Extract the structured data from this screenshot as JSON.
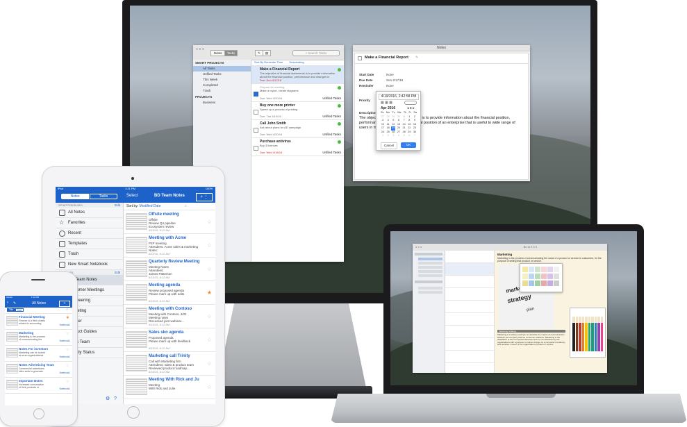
{
  "tasks_window": {
    "toolbar": {
      "notes_tab": "Notes",
      "tasks_tab": "Tasks",
      "search_placeholder": "Search Tasks"
    },
    "sort": {
      "by": "Sort By Reminder Time",
      "order": "Descending"
    },
    "sidebar": {
      "smart_header": "SMART PROJECTS",
      "smart_items": [
        "All Tasks",
        "Unfiled Tasks",
        "This Week",
        "Completed",
        "Trash"
      ],
      "projects_header": "PROJECTS",
      "projects": [
        "Business"
      ]
    },
    "tasks": [
      {
        "title": "Make a Financial Report",
        "desc": "The objective of financial statements is to provide information about the financial position, performance and changes in",
        "due": "Due: Sun 4/17/16",
        "project": ""
      },
      {
        "title": "Prepare for meeting",
        "desc": "Make a report, create diagrams",
        "due": "Due: Wed 4/20/16",
        "project": "Unfiled Tasks"
      },
      {
        "title": "Buy one more printer",
        "desc": "Speed up a process of printing",
        "due": "Due: Tue 4/19/16",
        "project": "Unfiled Tasks"
      },
      {
        "title": "Call John Smith",
        "desc": "Ask about plans for AD campaign",
        "due": "Due: Wed 4/20/16",
        "project": "Unfiled Tasks"
      },
      {
        "title": "Purchase antivirus",
        "desc": "Buy 3 licenses",
        "due": "Due: Wed 4/18/16",
        "project": "Unfiled Tasks"
      }
    ]
  },
  "notes_window": {
    "title": "Notes",
    "task_title": "Make a Financial Report",
    "fields": [
      {
        "label": "Start Date",
        "value": "None"
      },
      {
        "label": "Due Date",
        "value": "Sun 4/17/16"
      },
      {
        "label": "Reminder",
        "value": "None"
      },
      {
        "label": "Priority",
        "value": ""
      },
      {
        "label": "Description",
        "value": ""
      }
    ],
    "description": "The objective of financial statements is to provide information about the financial position, performance and changes in financial position of an enterprise that is useful to wide range of users in making economic decisions.",
    "date_picker": {
      "datetime": "4/19/2016, 2:42:58 PM",
      "month": "Apr 2016",
      "weekdays": [
        "Su",
        "Mo",
        "Tu",
        "We",
        "Th",
        "Fr",
        "Sa"
      ],
      "weeks": [
        [
          "27",
          "28",
          "29",
          "30",
          "31",
          "1",
          "2"
        ],
        [
          "3",
          "4",
          "5",
          "6",
          "7",
          "8",
          "9"
        ],
        [
          "10",
          "11",
          "12",
          "13",
          "14",
          "15",
          "16"
        ],
        [
          "17",
          "18",
          "19",
          "20",
          "21",
          "22",
          "23"
        ],
        [
          "24",
          "25",
          "26",
          "27",
          "28",
          "29",
          "30"
        ],
        [
          "1",
          "2",
          "3",
          "4",
          "5",
          "6",
          "7"
        ]
      ],
      "selected_day": "19",
      "cancel": "Cancel",
      "ok": "OK"
    }
  },
  "ipad": {
    "status_left": "iPad",
    "status_time": "1:21 PM",
    "status_right": "100%",
    "tabs": {
      "notes": "Notes",
      "tasks": "Tasks"
    },
    "select_label": "Select",
    "notebook_title": "BD Team Notes",
    "smart_header": "Smart Notebooks",
    "edit": "Edit",
    "smart_items": [
      "All Notes",
      "Favorites",
      "Recent",
      "Templates",
      "Trash",
      "New Smart Notebook"
    ],
    "notebooks_header": "Notebooks",
    "notebooks": [
      "BD Team Notes",
      "Customer Meetings",
      "Engineering",
      "Marketing",
      "Partner",
      "Product Guides",
      "Sales Team",
      "Weekly Status"
    ],
    "sort_by": "Sort by:",
    "sort_value": "Modified Date",
    "notes": [
      {
        "title": "Offsite meeting",
        "l1": "Offsite",
        "l2": "Review Q4 pipeline",
        "l3": "Ecosystem review",
        "date": "6/15/15, 8:12 AM",
        "fav": false
      },
      {
        "title": "Meeting with Acme",
        "l1": "P2P meeting",
        "l2": "Attendees: Acme sales & marketing",
        "l3": "Notes:",
        "date": "6/15/15, 8:12 AM",
        "fav": false
      },
      {
        "title": "Quarterly Review Meeting",
        "l1": "Meeting Notes",
        "l2": "Attendees:",
        "l3": "James Patterson",
        "date": "6/15/15, 8:12 AM",
        "fav": false
      },
      {
        "title": "Meeting agenda",
        "l1": "Review proposed agenda",
        "l2": "Please mark up with edits",
        "l3": "",
        "date": "6/15/15, 8:12 AM",
        "fav": true
      },
      {
        "title": "Meeting with Contoso",
        "l1": "Meeting with Contoso, 4/22",
        "l2": "Meeting notes",
        "l3": "Discussed joint webinar...",
        "date": "6/15/15, 8:12 AM",
        "fav": false
      },
      {
        "title": "Sales sko agenda",
        "l1": "Proposed agenda",
        "l2": "Please mark up with feedback",
        "l3": "",
        "date": "6/15/15, 8:12 AM",
        "fav": false
      },
      {
        "title": "Marketing call Trinity",
        "l1": "Call with Marketing firm",
        "l2": "Attendees: sales & product team",
        "l3": "Reviewed product roadmap...",
        "date": "6/15/15, 8:12 AM",
        "fav": false
      },
      {
        "title": "Meeting  With Rick and Ju",
        "l1": "Meeting",
        "l2": "With Rick and Julie",
        "l3": "",
        "date": "",
        "fav": false
      }
    ]
  },
  "iphone": {
    "status_left": "Carrier",
    "status_time": "1:12 PM",
    "title": "All Notes",
    "tabs": [
      "Title",
      "Date"
    ],
    "notes": [
      {
        "title": "Financial Meeting",
        "l1": "Finance is a field closely",
        "l2": "related to accounting",
        "nb": "Notebook1"
      },
      {
        "title": "Marketing",
        "l1": "Marketing is the process",
        "l2": "of communicating the",
        "nb": "Notebook1"
      },
      {
        "title": "Notes For investors",
        "l1": "Marketing can be looked",
        "l2": "at as an organizational",
        "nb": "Notebook1"
      },
      {
        "title": "Notes Advertising Team",
        "l1": "Commercial advertisers",
        "l2": "often seek to generate",
        "nb": "Notebook1"
      },
      {
        "title": "Important Notes",
        "l1": "Increased consumption",
        "l2": "of their products or",
        "nb": "Notebook1"
      }
    ]
  },
  "macbook": {
    "doc_heading": "Marketing",
    "doc_text": "Marketing is the process of communicating the value of a product or service to customers, for the purpose of selling that product or service.",
    "board_words": [
      "marketing",
      "strategy",
      "plan"
    ],
    "caption_heading": "Marketing Strategy",
    "caption_text": "Marketing is a widely used term to describe the means of communication between the company and the consumer audience. Marketing is the adaptation of the commercial activities and use of institutions by the organizations with a purpose to induce change on a consumer's tendency and behavior in favor of the organization's product or service."
  }
}
